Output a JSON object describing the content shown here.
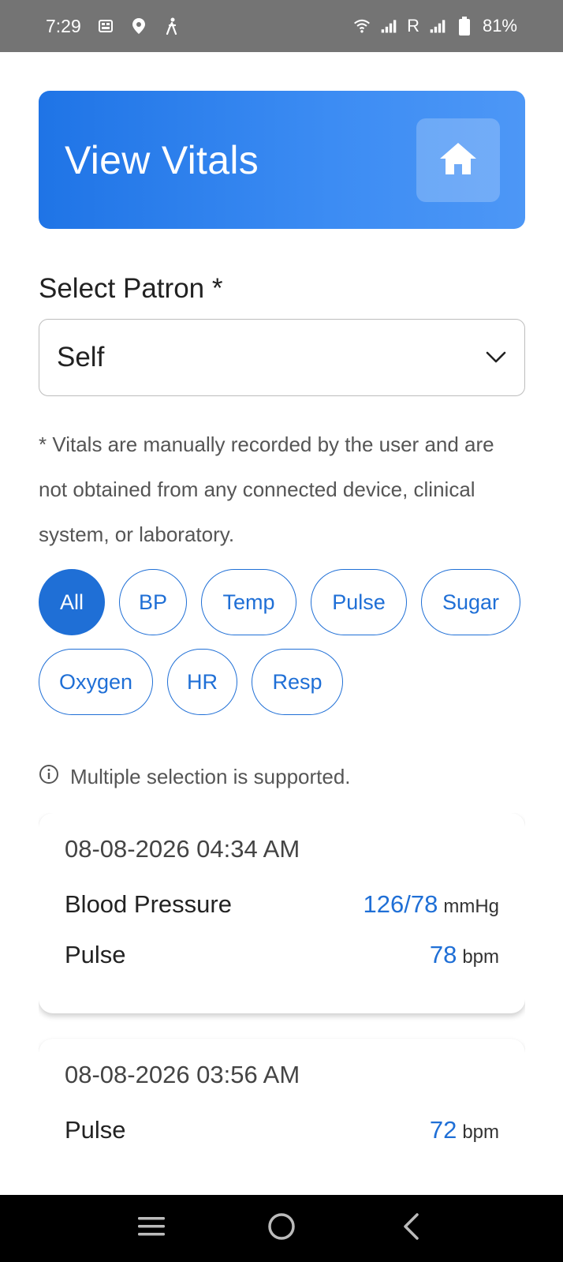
{
  "status_bar": {
    "time": "7:29",
    "carrier_r": "R",
    "battery": "81%"
  },
  "header": {
    "title": "View Vitals",
    "home_icon": "home-icon"
  },
  "patron": {
    "label": "Select Patron *",
    "selected": "Self"
  },
  "disclaimer": "* Vitals are manually recorded by the user and are not obtained from any connected device, clinical system, or laboratory.",
  "filters": {
    "chips": [
      {
        "label": "All",
        "active": true
      },
      {
        "label": "BP",
        "active": false
      },
      {
        "label": "Temp",
        "active": false
      },
      {
        "label": "Pulse",
        "active": false
      },
      {
        "label": "Sugar",
        "active": false
      },
      {
        "label": "Oxygen",
        "active": false
      },
      {
        "label": "HR",
        "active": false
      },
      {
        "label": "Resp",
        "active": false
      }
    ],
    "info": "Multiple selection is supported."
  },
  "records": [
    {
      "date": "08-08-2026 04:34 AM",
      "rows": [
        {
          "label": "Blood Pressure",
          "value": "126/78",
          "unit": "mmHg"
        },
        {
          "label": "Pulse",
          "value": "78",
          "unit": "bpm"
        }
      ]
    },
    {
      "date": "08-08-2026 03:56 AM",
      "rows": [
        {
          "label": "Pulse",
          "value": "72",
          "unit": "bpm"
        }
      ]
    }
  ],
  "colors": {
    "accent": "#1f6fd6",
    "header_gradient_start": "#1f74e6",
    "header_gradient_end": "#4d97f6"
  }
}
